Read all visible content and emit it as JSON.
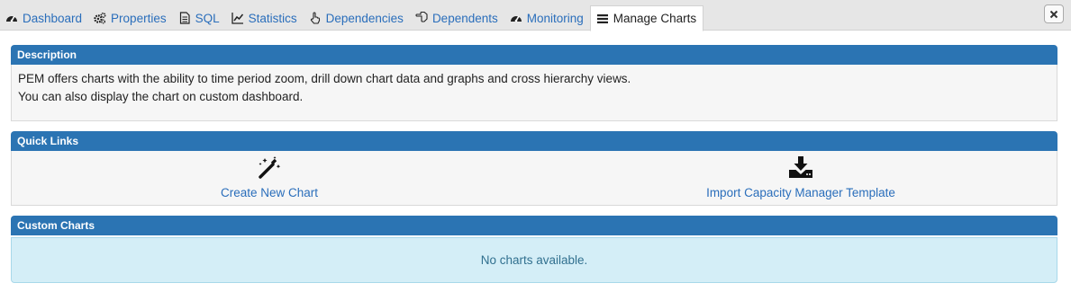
{
  "tabs": [
    {
      "label": "Dashboard",
      "icon": "dashboard-icon",
      "active": false
    },
    {
      "label": "Properties",
      "icon": "gears-icon",
      "active": false
    },
    {
      "label": "SQL",
      "icon": "document-icon",
      "active": false
    },
    {
      "label": "Statistics",
      "icon": "line-chart-icon",
      "active": false
    },
    {
      "label": "Dependencies",
      "icon": "hand-pointer-icon",
      "active": false
    },
    {
      "label": "Dependents",
      "icon": "hand-left-icon",
      "active": false
    },
    {
      "label": "Monitoring",
      "icon": "dashboard-icon",
      "active": false
    },
    {
      "label": "Manage Charts",
      "icon": "list-icon",
      "active": true
    }
  ],
  "description": {
    "title": "Description",
    "lines": [
      "PEM offers charts with the ability to time period zoom, drill down chart data and graphs and cross hierarchy views.",
      "You can also display the chart on custom dashboard."
    ]
  },
  "quick_links": {
    "title": "Quick Links",
    "items": [
      {
        "label": "Create New Chart",
        "icon": "magic-wand-icon"
      },
      {
        "label": "Import Capacity Manager Template",
        "icon": "download-icon"
      }
    ]
  },
  "custom_charts": {
    "title": "Custom Charts",
    "empty_message": "No charts available."
  },
  "colors": {
    "panel_header": "#2b74b3",
    "link": "#2a6ebb",
    "info_background": "#d4eef7",
    "info_text": "#31708f"
  }
}
